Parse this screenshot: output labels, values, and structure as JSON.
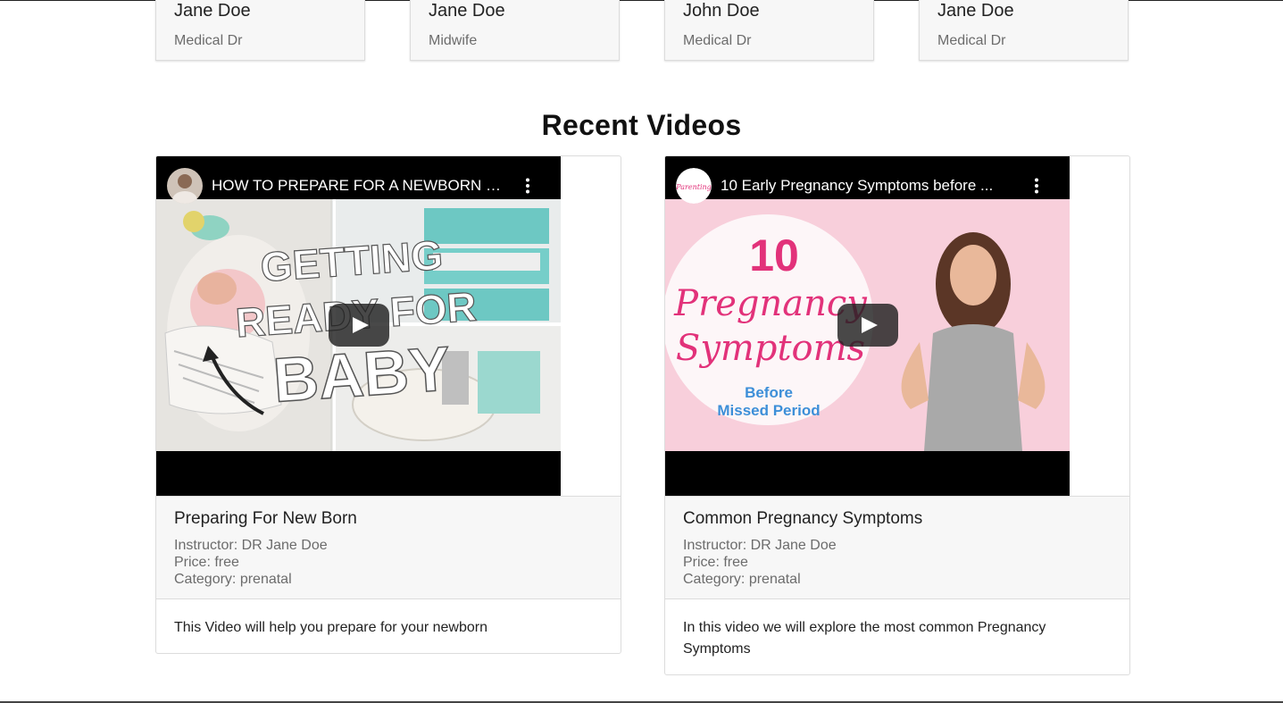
{
  "doctors": [
    {
      "name": "Jane Doe",
      "role": "Medical Dr"
    },
    {
      "name": "Jane Doe",
      "role": "Midwife"
    },
    {
      "name": "John Doe",
      "role": "Medical Dr"
    },
    {
      "name": "Jane Doe",
      "role": "Medical Dr"
    }
  ],
  "section": {
    "title": "Recent Videos"
  },
  "videos": [
    {
      "player_title": "HOW TO PREPARE FOR A NEWBORN B...",
      "thumb_text": [
        "GETTING",
        "READY FOR",
        "BABY"
      ],
      "title": "Preparing For New Born",
      "instructor": "Instructor: DR Jane Doe",
      "price": "Price: free",
      "category": "Category: prenatal",
      "description": "This Video will help you prepare for your newborn"
    },
    {
      "player_title": "10 Early Pregnancy Symptoms before ...",
      "thumb_text": [
        "10",
        "Pregnancy",
        "Symptoms",
        "Before",
        "Missed Period"
      ],
      "channel_logo_text": "Parenting",
      "title": "Common Pregnancy Symptoms",
      "instructor": "Instructor: DR Jane Doe",
      "price": "Price: free",
      "category": "Category: prenatal",
      "description": "In this video we will explore the most common Pregnancy Symptoms"
    }
  ],
  "colors": {
    "card_bg": "#f7f7f7",
    "border": "#dcdcdc",
    "muted_text": "#6c6c6c",
    "play_button": "#212121",
    "thumb2_pink": "#f6c9d6",
    "thumb2_text": "#e2327a"
  }
}
